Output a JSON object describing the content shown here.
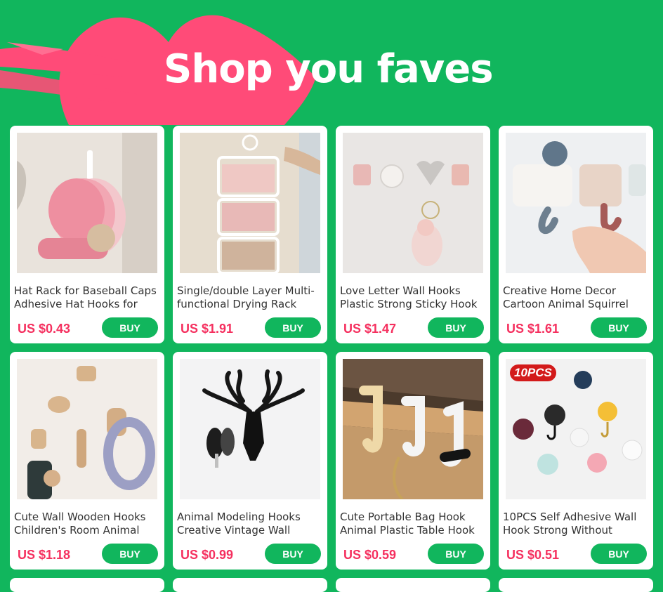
{
  "banner": {
    "title": "Shop you faves"
  },
  "buy_label": "BUY",
  "products": [
    {
      "name": "Hat Rack for Baseball Caps Adhesive Hat Hooks for",
      "price": "US $0.43",
      "image": "hat-rack-photo"
    },
    {
      "name": "Single/double Layer Multi-functional Drying Rack",
      "price": "US $1.91",
      "image": "drying-rack-photo"
    },
    {
      "name": "Love Letter Wall Hooks Plastic Strong Sticky Hook",
      "price": "US $1.47",
      "image": "love-hooks-photo"
    },
    {
      "name": "Creative Home Decor Cartoon Animal Squirrel",
      "price": "US $1.61",
      "image": "squirrel-hook-photo"
    },
    {
      "name": "Cute Wall Wooden Hooks Children's Room Animal",
      "price": "US $1.18",
      "image": "wooden-animal-hooks-photo"
    },
    {
      "name": "Animal Modeling Hooks Creative Vintage Wall",
      "price": "US $0.99",
      "image": "deer-head-hook-photo"
    },
    {
      "name": "Cute Portable Bag Hook Animal Plastic Table Hook",
      "price": "US $0.59",
      "image": "table-bag-hooks-photo"
    },
    {
      "name": "10PCS Self Adhesive Wall Hook Strong Without",
      "price": "US $0.51",
      "image": "colored-hooks-photo",
      "badge": "10PCS"
    }
  ],
  "colors": {
    "background": "#11b65d",
    "price": "#f5305f",
    "button": "#11b65d",
    "brush": "#ff4b78"
  }
}
